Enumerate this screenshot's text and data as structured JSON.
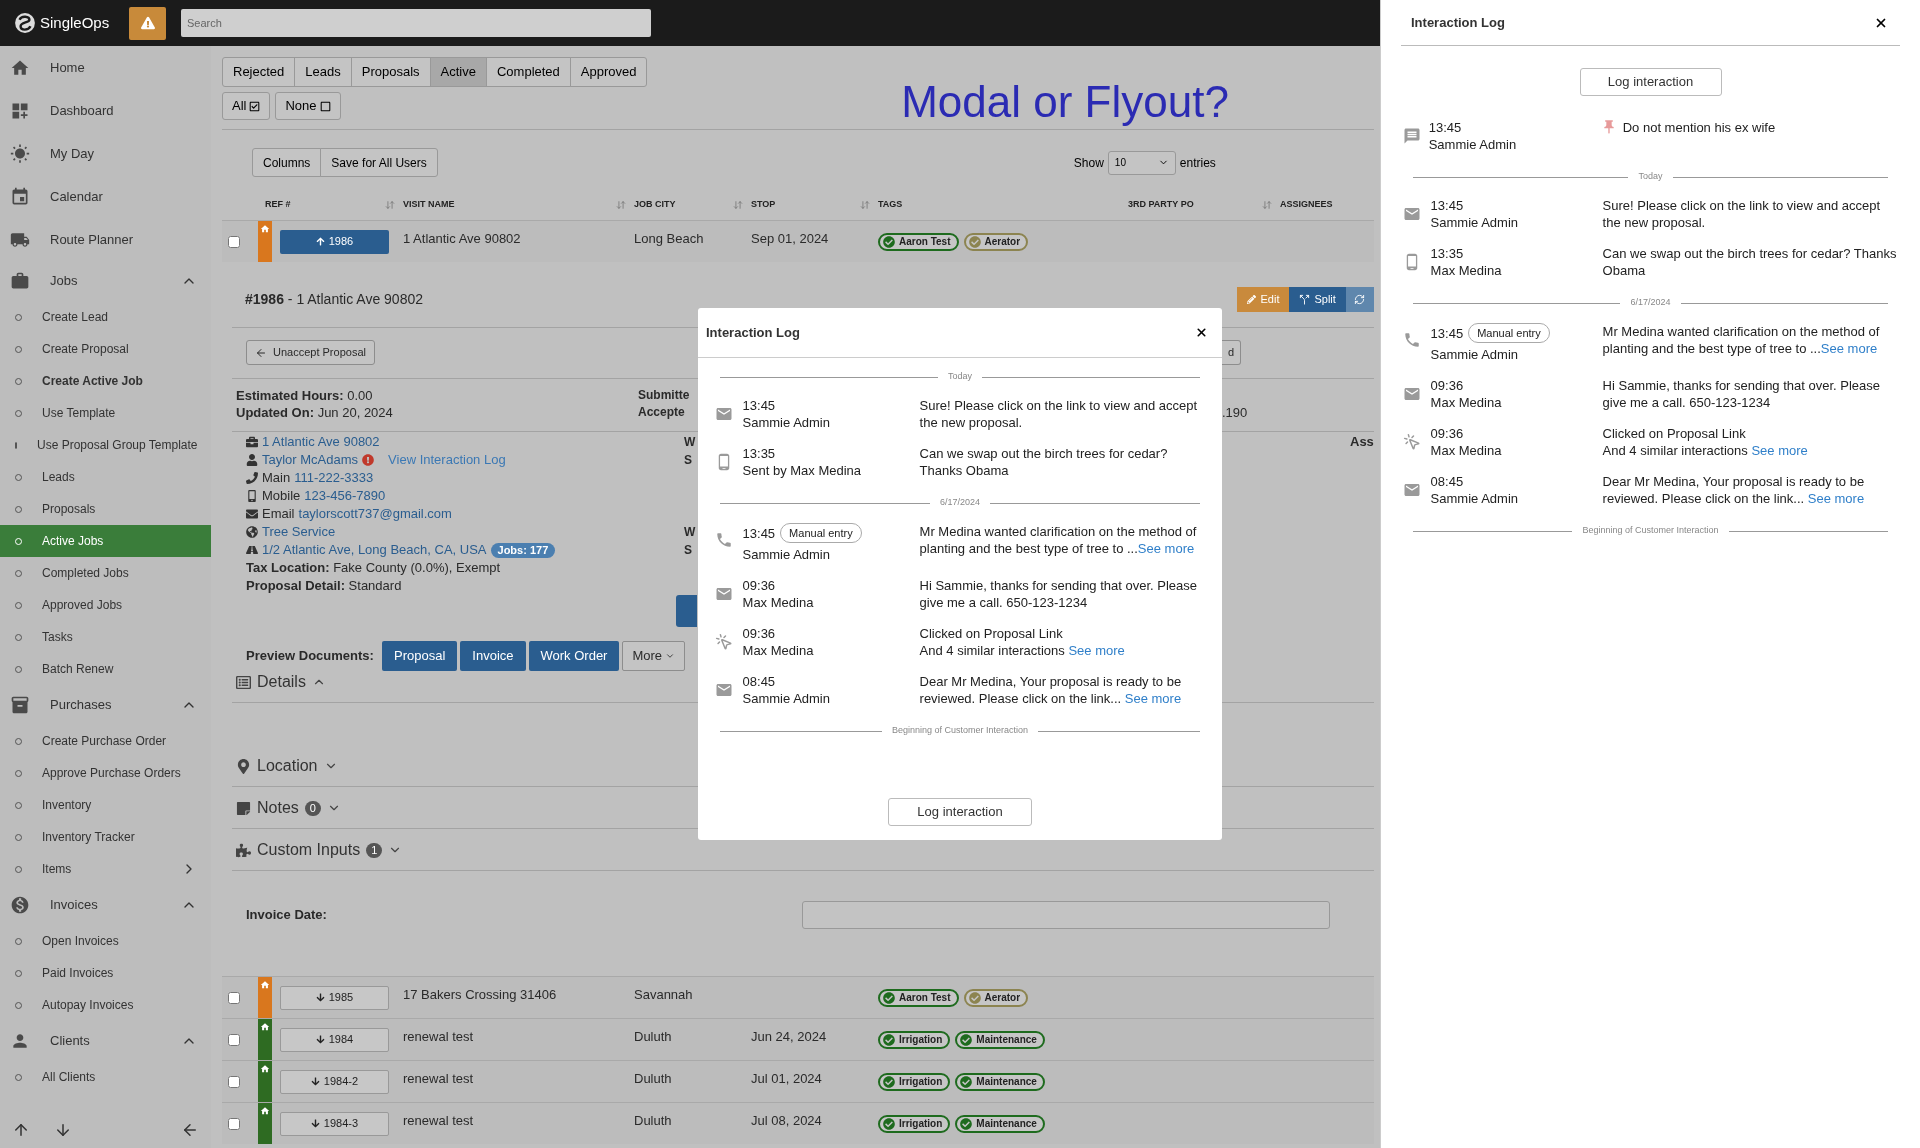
{
  "topbar": {
    "logo": "SingleOps",
    "search": {
      "placeholder": "Search"
    }
  },
  "sidebar": {
    "items": [
      {
        "kind": "page",
        "label": "Home"
      },
      {
        "kind": "page",
        "label": "Dashboard"
      },
      {
        "kind": "page",
        "label": "My Day"
      },
      {
        "kind": "page",
        "label": "Calendar"
      },
      {
        "kind": "page",
        "label": "Route Planner"
      },
      {
        "kind": "group",
        "label": "Jobs",
        "expanded": true
      },
      {
        "kind": "link",
        "label": "Create Lead",
        "selected": false,
        "bold": false
      },
      {
        "kind": "link",
        "label": "Create Proposal",
        "selected": false,
        "bold": false
      },
      {
        "kind": "link",
        "label": "Create Active Job",
        "selected": false,
        "bold": true
      },
      {
        "kind": "link",
        "label": "Use Template",
        "selected": false,
        "bold": false
      },
      {
        "kind": "link",
        "label": "Use Proposal Group Template",
        "selected": false,
        "bold": false
      },
      {
        "kind": "link",
        "label": "Leads",
        "selected": false,
        "bold": false
      },
      {
        "kind": "link",
        "label": "Proposals",
        "selected": false,
        "bold": false
      },
      {
        "kind": "link",
        "label": "Active Jobs",
        "selected": true,
        "bold": false
      },
      {
        "kind": "link",
        "label": "Completed Jobs",
        "selected": false,
        "bold": false
      },
      {
        "kind": "link",
        "label": "Approved Jobs",
        "selected": false,
        "bold": false
      },
      {
        "kind": "link",
        "label": "Tasks",
        "selected": false,
        "bold": false
      },
      {
        "kind": "link",
        "label": "Batch Renew",
        "selected": false,
        "bold": false
      },
      {
        "kind": "group",
        "label": "Purchases",
        "expanded": true
      },
      {
        "kind": "link",
        "label": "Create Purchase Order",
        "selected": false,
        "bold": false
      },
      {
        "kind": "link",
        "label": "Approve Purchase Orders",
        "selected": false,
        "bold": false
      },
      {
        "kind": "link",
        "label": "Inventory",
        "selected": false,
        "bold": false
      },
      {
        "kind": "link",
        "label": "Inventory Tracker",
        "selected": false,
        "bold": false
      },
      {
        "kind": "subgroup",
        "label": "Items",
        "expanded": false
      },
      {
        "kind": "group",
        "label": "Invoices",
        "expanded": true
      },
      {
        "kind": "link",
        "label": "Open Invoices",
        "selected": false,
        "bold": false
      },
      {
        "kind": "link",
        "label": "Paid Invoices",
        "selected": false,
        "bold": false
      },
      {
        "kind": "link",
        "label": "Autopay Invoices",
        "selected": false,
        "bold": false
      },
      {
        "kind": "group",
        "label": "Clients",
        "expanded": true
      },
      {
        "kind": "link",
        "label": "All Clients",
        "selected": false,
        "bold": false
      }
    ]
  },
  "status_tabs": [
    {
      "label": "Rejected",
      "selected": false
    },
    {
      "label": "Leads",
      "selected": false
    },
    {
      "label": "Proposals",
      "selected": false
    },
    {
      "label": "Active",
      "selected": true
    },
    {
      "label": "Completed",
      "selected": false
    },
    {
      "label": "Approved",
      "selected": false
    }
  ],
  "select_buttons": [
    "All",
    "None"
  ],
  "banner": "Modal or Flyout?",
  "table_tools": {
    "buttons": [
      "Columns",
      "Save for All Users"
    ],
    "show_label": "Show",
    "page_size": "10",
    "entries_label": "entries"
  },
  "table": {
    "columns": [
      {
        "label": "REF #",
        "sortable": true
      },
      {
        "label": "VISIT NAME",
        "sortable": true
      },
      {
        "label": "JOB CITY",
        "sortable": true
      },
      {
        "label": "STOP",
        "sortable": true
      },
      {
        "label": "TAGS",
        "sortable": false
      },
      {
        "label": "3RD PARTY PO",
        "sortable": true
      },
      {
        "label": "ASSIGNEES",
        "sortable": false
      }
    ],
    "rows": [
      {
        "checked": false,
        "color": "#d9771e",
        "ref": "1986",
        "expanded": true,
        "visit_name": "1 Atlantic Ave 90802",
        "job_city": "Long Beach",
        "stop": "Sep 01, 2024",
        "tags": [
          {
            "label": "Aaron Test",
            "color": "#1e6b1e"
          },
          {
            "label": "Aerator",
            "color": "#8c8450"
          }
        ]
      },
      {
        "checked": false,
        "color": "#d9771e",
        "ref": "1985",
        "expanded": false,
        "visit_name": "17 Bakers Crossing 31406",
        "job_city": "Savannah",
        "tags": [
          {
            "label": "Aaron Test",
            "color": "#1e6b1e"
          },
          {
            "label": "Aerator",
            "color": "#8c8450"
          }
        ]
      },
      {
        "checked": false,
        "color": "#2e6b22",
        "ref": "1984",
        "expanded": false,
        "visit_name": "renewal test",
        "job_city": "Duluth",
        "stop": "Jun 24, 2024",
        "tags": [
          {
            "label": "Irrigation",
            "color": "#1e6b1e"
          },
          {
            "label": "Maintenance",
            "color": "#1e6b1e"
          }
        ]
      },
      {
        "checked": false,
        "color": "#2e6b22",
        "ref": "1984-2",
        "expanded": false,
        "visit_name": "renewal test",
        "job_city": "Duluth",
        "stop": "Jul 01, 2024",
        "tags": [
          {
            "label": "Irrigation",
            "color": "#1e6b1e"
          },
          {
            "label": "Maintenance",
            "color": "#1e6b1e"
          }
        ]
      },
      {
        "checked": false,
        "color": "#2e6b22",
        "ref": "1984-3",
        "expanded": false,
        "visit_name": "renewal test",
        "job_city": "Duluth",
        "stop": "Jul 08, 2024",
        "tags": [
          {
            "label": "Irrigation",
            "color": "#1e6b1e"
          },
          {
            "label": "Maintenance",
            "color": "#1e6b1e"
          }
        ]
      }
    ]
  },
  "job_detail": {
    "title": "**#1986** - 1 Atlantic Ave 90802",
    "actions": [
      "Edit",
      "Split"
    ],
    "unaccept_button": "Unaccept Proposal",
    "hidden_button_fragment": "d",
    "fields": [
      {
        "label": "Estimated Hours:",
        "value": "0.00"
      },
      {
        "label": "Updated On:",
        "value": "Jun 20, 2024"
      }
    ],
    "side_fragments": [
      "Submitte",
      "Accepte"
    ],
    "right_fragment": ".190",
    "contacts": [
      {
        "kind": "address",
        "value": "1 Atlantic Ave 90802"
      },
      {
        "kind": "customer",
        "value": "Taylor McAdams",
        "alert": true,
        "extra_link": "View Interaction Log"
      },
      {
        "kind": "main",
        "label": "Main",
        "value": "111-222-3333"
      },
      {
        "kind": "mobile",
        "label": "Mobile",
        "value": "123-456-7890"
      },
      {
        "kind": "email",
        "label": "Email",
        "value": "taylorscott737@gmail.com"
      },
      {
        "kind": "service",
        "value": "Tree Service"
      },
      {
        "kind": "location",
        "value": "1/2 Atlantic Ave, Long Beach, CA, USA",
        "badge": "Jobs: 177"
      }
    ],
    "extra_fields": [
      {
        "label": "Tax Location:",
        "value": "Fake County (0.0%), Exempt"
      },
      {
        "label": "Proposal Detail:",
        "value": "Standard"
      }
    ],
    "column_fragments": [
      [
        "W",
        "S"
      ],
      [
        "W",
        "S"
      ]
    ],
    "assignee_fragment": "Ass",
    "preview_label": "Preview Documents:",
    "preview_buttons": [
      "Proposal",
      "Invoice",
      "Work Order"
    ],
    "more_button": "More",
    "sections": [
      {
        "label": "Details",
        "expanded": true
      },
      {
        "label": "Location",
        "expanded": false
      },
      {
        "label": "Notes",
        "count": "0",
        "expanded": false
      },
      {
        "label": "Custom Inputs",
        "count": "1",
        "expanded": false
      }
    ],
    "invoice_date_label": "Invoice Date:"
  },
  "modal": {
    "title": "Interaction Log",
    "button": "Log interaction",
    "items": [
      {
        "kind": "separator",
        "label": "Today"
      },
      {
        "kind": "email",
        "time": "13:45",
        "author": "Sammie Admin",
        "message": "Sure! Please click on the link to view and accept the new proposal."
      },
      {
        "kind": "mobile",
        "time": "13:35",
        "author": "Sent by Max Medina",
        "message": "Can we swap out the birch trees for cedar? Thanks Obama"
      },
      {
        "kind": "separator",
        "label": "6/17/2024"
      },
      {
        "kind": "phone",
        "time": "13:45",
        "badge": "Manual entry",
        "author": "Sammie Admin",
        "message": "Mr Medina wanted clarification on the method of planting and the best type of tree to ...",
        "link": "See more"
      },
      {
        "kind": "email",
        "time": "09:36",
        "author": "Max Medina",
        "message": "Hi Sammie, thanks for sending that over. Please give me a call. 650-123-1234"
      },
      {
        "kind": "click",
        "time": "09:36",
        "author": "Max Medina",
        "message": "Clicked on Proposal Link",
        "detail": "And 4 similar interactions ",
        "link": "See more"
      },
      {
        "kind": "email",
        "time": "08:45",
        "author": "Sammie Admin",
        "message": "Dear Mr Medina, Your proposal is ready to be reviewed. Please click on the link... ",
        "link": "See more"
      },
      {
        "kind": "separator",
        "label": "Beginning of  Customer Interaction"
      }
    ]
  },
  "flyout": {
    "title": "Interaction Log",
    "button": "Log interaction",
    "items": [
      {
        "kind": "note",
        "time": "13:45",
        "author": "Sammie Admin",
        "pinned": true,
        "message": "Do not mention his ex wife"
      },
      {
        "kind": "separator",
        "label": "Today"
      },
      {
        "kind": "email",
        "time": "13:45",
        "author": "Sammie Admin",
        "message": "Sure! Please click on the link to view and accept the new proposal."
      },
      {
        "kind": "mobile",
        "time": "13:35",
        "author": "Max Medina",
        "message": "Can we swap out the birch trees for cedar? Thanks Obama"
      },
      {
        "kind": "separator",
        "label": "6/17/2024"
      },
      {
        "kind": "phone",
        "time": "13:45",
        "badge": "Manual entry",
        "author": "Sammie Admin",
        "message": "Mr Medina wanted clarification on the method of planting and the best type of tree to ...",
        "link": "See more"
      },
      {
        "kind": "email",
        "time": "09:36",
        "author": "Max Medina",
        "message": "Hi Sammie, thanks for sending that over. Please give me a call. 650-123-1234"
      },
      {
        "kind": "click",
        "time": "09:36",
        "author": "Max Medina",
        "message": "Clicked on Proposal Link",
        "detail": "And 4 similar interactions ",
        "link": "See more"
      },
      {
        "kind": "email",
        "time": "08:45",
        "author": "Sammie Admin",
        "message": "Dear Mr Medina, Your proposal is ready to be reviewed. Please click on the link... ",
        "link": "See more"
      },
      {
        "kind": "separator",
        "label": "Beginning of  Customer Interaction"
      }
    ]
  }
}
